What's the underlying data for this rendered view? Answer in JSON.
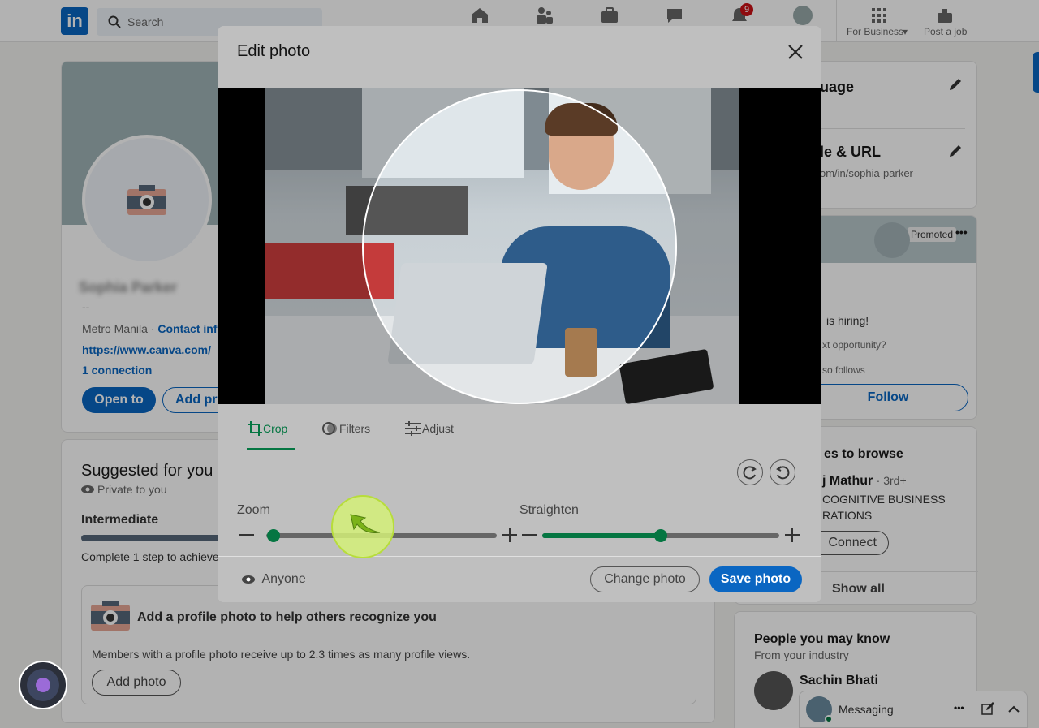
{
  "nav": {
    "logo": "in",
    "search_placeholder": "Search",
    "notifications_badge": "9",
    "for_business_label": "For Business",
    "post_job_label": "Post a job"
  },
  "profile": {
    "name_blurred": "Sophia Parker",
    "headline": "--",
    "location": "Metro Manila",
    "contact_info": "Contact info",
    "website": "https://www.canva.com/",
    "connections": "1 connection",
    "open_to": "Open to",
    "add_profile_section": "Add pr"
  },
  "suggested": {
    "title": "Suggested for you",
    "privacy": "Private to you",
    "level": "Intermediate",
    "progress_text": "Complete 1 step to achieve",
    "photo_prompt": "Add a profile photo to help others recognize you",
    "photo_desc": "Members with a profile photo receive up to 2.3 times as many profile views.",
    "add_photo": "Add photo"
  },
  "right_rail": {
    "language": "uage",
    "profile_url_title": "le & URL",
    "profile_url": "om/in/sophia-parker-",
    "promoted": "Promoted",
    "hiring": "is hiring!",
    "opportunity": "xt opportunity?",
    "follows": "so follows",
    "follow_btn": "Follow",
    "browse_title": "es to browse",
    "browse_person": "j Mathur",
    "browse_degree": "· 3rd+",
    "browse_company_1": "COGNITIVE BUSINESS",
    "browse_company_2": "RATIONS",
    "connect_btn": "Connect",
    "show_all": "Show all",
    "pymk_title": "People you may know",
    "pymk_sub": "From your industry",
    "pymk_person": "Sachin Bhati",
    "messaging": "Messaging"
  },
  "modal": {
    "title": "Edit photo",
    "tabs": [
      {
        "label": "Crop",
        "active": true
      },
      {
        "label": "Filters",
        "active": false
      },
      {
        "label": "Adjust",
        "active": false
      }
    ],
    "zoom_label": "Zoom",
    "zoom_value": 0.03,
    "straighten_label": "Straighten",
    "straighten_value": 0.5,
    "visibility": "Anyone",
    "change_photo": "Change photo",
    "save_photo": "Save photo"
  },
  "colors": {
    "brand": "#0a66c2",
    "accent_green": "#057642"
  }
}
